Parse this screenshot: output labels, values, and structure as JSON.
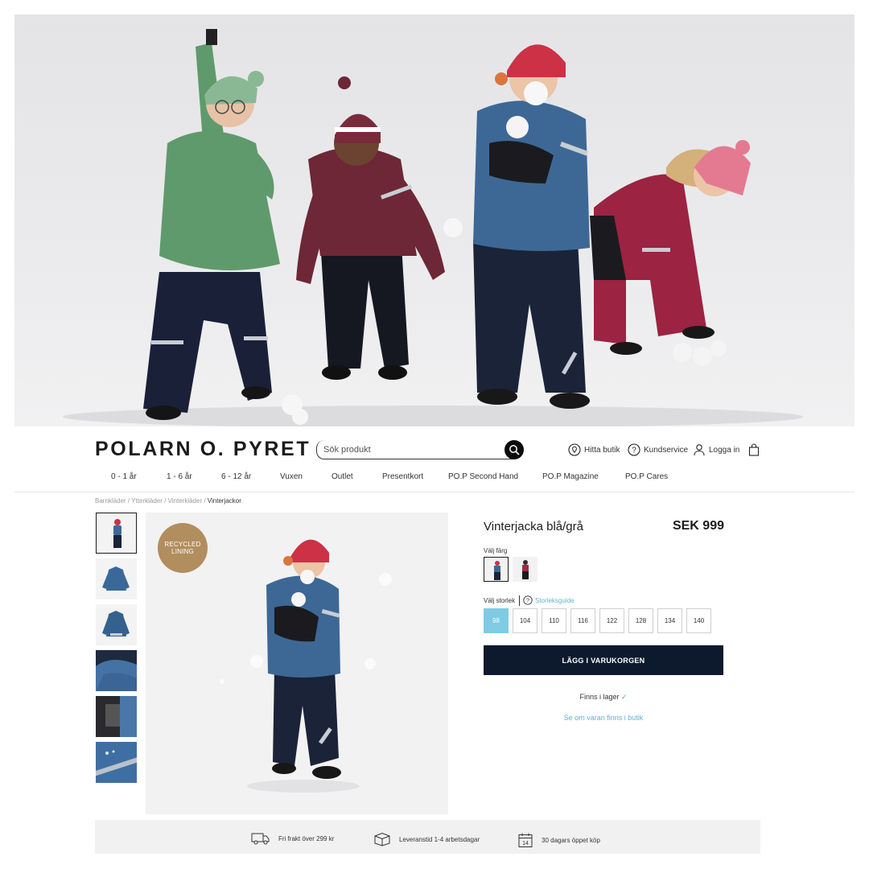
{
  "brand": {
    "logo_text": "POLARN O. PYRET"
  },
  "search": {
    "placeholder": "Sök produkt"
  },
  "utility_nav": [
    {
      "label": "Hitta butik",
      "icon": "location-pin-icon"
    },
    {
      "label": "Kundservice",
      "icon": "question-circle-icon"
    },
    {
      "label": "Logga in",
      "icon": "user-icon"
    },
    {
      "label": "",
      "icon": "shopping-bag-icon"
    }
  ],
  "main_nav": [
    "0 - 1 år",
    "1 - 6 år",
    "6 - 12 år",
    "Vuxen",
    "Outlet",
    "Presentkort",
    "PO.P Second Hand",
    "PO.P Magazine",
    "PO.P Cares"
  ],
  "breadcrumb": {
    "items": [
      "Barnkläder",
      "Ytterkläder",
      "Vinterkläder"
    ],
    "separator": " / ",
    "current": "Vinterjackor"
  },
  "badge": {
    "line1": "RECYCLED",
    "line2": "LINING"
  },
  "product": {
    "title": "Vinterjacka blå/grå",
    "price": "SEK 999",
    "color_label": "Välj färg",
    "size_label": "Välj storlek",
    "size_guide": "Storleksguide",
    "sizes": [
      "98",
      "104",
      "110",
      "116",
      "122",
      "128",
      "134",
      "140"
    ],
    "selected_size": "98",
    "add_to_cart": "LÄGG I VARUKORGEN",
    "stock_text": "Finns i lager",
    "store_link": "Se om varan finns i butik"
  },
  "usps": [
    {
      "label": "Fri frakt över 299 kr",
      "icon": "truck-icon"
    },
    {
      "label": "Leveranstid 1-4 arbetsdagar",
      "icon": "box-icon"
    },
    {
      "label": "30 dagars öppet köp",
      "icon": "calendar-icon",
      "icon_text": "14"
    }
  ],
  "colors": {
    "accent_blue": "#7ecbe3",
    "link_blue": "#5fb3cf",
    "cart_button": "#0d1a2e",
    "badge_brown": "#b28d5e"
  }
}
